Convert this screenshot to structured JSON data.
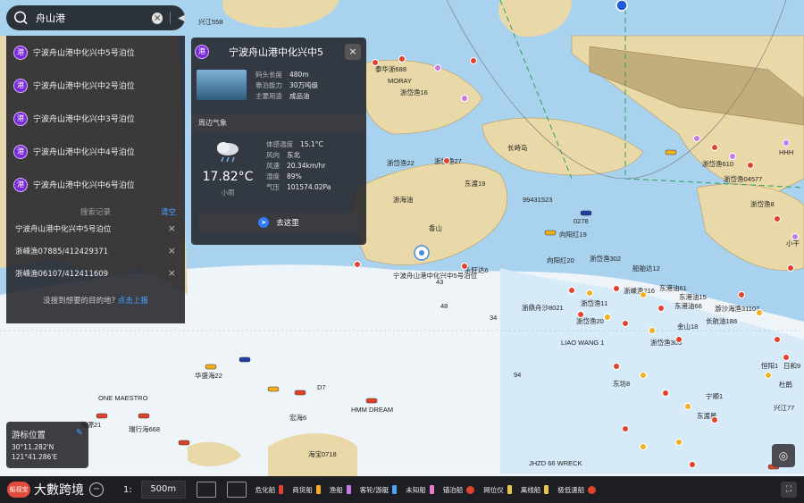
{
  "search": {
    "value": "舟山港",
    "clear_glyph": "×",
    "collapse_glyph": "◀"
  },
  "results": [
    {
      "badge": "港",
      "label": "宁波舟山港中化兴中5号泊位"
    },
    {
      "badge": "港",
      "label": "宁波舟山港中化兴中2号泊位"
    },
    {
      "badge": "港",
      "label": "宁波舟山港中化兴中3号泊位"
    },
    {
      "badge": "港",
      "label": "宁波舟山港中化兴中4号泊位"
    },
    {
      "badge": "港",
      "label": "宁波舟山港中化兴中6号泊位"
    }
  ],
  "history": {
    "title": "搜索记录",
    "clear_label": "清空",
    "items": [
      "宁波舟山港中化兴中5号泊位",
      "浙嵊渔07885/412429371",
      "浙嵊渔06107/412411609"
    ]
  },
  "not_found": {
    "text": "没搜到想要的目的地?",
    "link": "点击上报"
  },
  "card": {
    "badge": "港",
    "title": "宁波舟山港中化兴中5",
    "close": "×",
    "fields": [
      {
        "k": "码头长度",
        "v": "480m"
      },
      {
        "k": "靠泊能力",
        "v": "30万吨级"
      },
      {
        "k": "主要用途",
        "v": "成品油"
      }
    ],
    "weather_header": "周边气象",
    "temp": "17.82°C",
    "condition": "小雨",
    "weather": [
      {
        "k": "体感温度",
        "v": "15.1°C"
      },
      {
        "k": "风向",
        "v": "东北"
      },
      {
        "k": "风速",
        "v": "20.34km/hr"
      },
      {
        "k": "湿度",
        "v": "89%"
      },
      {
        "k": "气压",
        "v": "101574.02Pa"
      }
    ],
    "goto": "去这里"
  },
  "cursor": {
    "title": "游标位置",
    "lat": "30°11.282'N",
    "lon": "121°41.286'E"
  },
  "bottom": {
    "logo_mark": "船视宝",
    "brand": "大數跨境",
    "scale_prefix": "1:",
    "scale_value": "500m",
    "legend": [
      {
        "label": "危化船",
        "color": "#e0422c"
      },
      {
        "label": "商货船",
        "color": "#f2b01e"
      },
      {
        "label": "渔船",
        "color": "#c678e6"
      },
      {
        "label": "客轮/游艇",
        "color": "#4fa3f0"
      },
      {
        "label": "未知船",
        "color": "#e67ad1"
      },
      {
        "label": "锚泊船",
        "color": "#e0422c"
      },
      {
        "label": "网位仪",
        "color": "#e6c34a"
      },
      {
        "label": "离线船",
        "color": "#e6c34a"
      },
      {
        "label": "极低速船",
        "color": "#e0422c"
      }
    ],
    "fullscreen_glyph": "⛶"
  },
  "map_labels": [
    "长峙岛",
    "香山",
    "小干",
    "LIAO WANG 1",
    "ONE MAESTRO",
    "HMM DREAM",
    "JHZD 66 WRECK",
    "MORAY",
    "HHH",
    "D7",
    "94",
    "43",
    "48",
    "34",
    "兴江558",
    "泰华浙688",
    "浙岱渔22",
    "永旺达6",
    "船舶达12",
    "东港油66",
    "浙鼎舟沙8021",
    "东坊8",
    "浙岱渔16",
    "浙岱渔27",
    "东港油15",
    "长航油188",
    "游沙海渔31107",
    "浙海油",
    "东渡19",
    "华盛海22",
    "宏海6",
    "瑞行海668",
    "海源21",
    "海宝0718",
    "99431523",
    "0278",
    "向阳红19",
    "向阳红20",
    "浙岱渔302",
    "浙嵊渔216",
    "东港油61",
    "宁波舟山港中化兴中5号泊位",
    "浙岱渔11",
    "浙岱渔20",
    "浙岱渔305",
    "金山18",
    "兴江77",
    "宁顺1",
    "东渡星",
    "恒阳1",
    "日和9",
    "杜鹃",
    "浙岱渔04577",
    "浙岱渔610",
    "浙岱渔8"
  ]
}
